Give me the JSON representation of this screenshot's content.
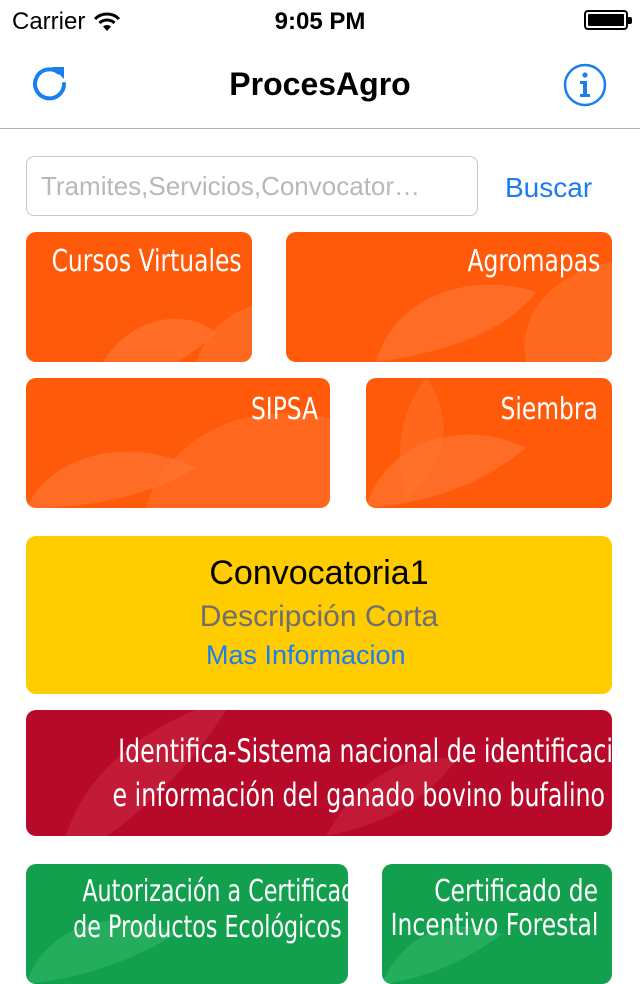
{
  "status_bar": {
    "carrier": "Carrier",
    "time": "9:05 PM"
  },
  "nav": {
    "title": "ProcesAgro",
    "refresh_icon": "refresh-icon",
    "info_icon": "info-icon"
  },
  "search": {
    "placeholder": "Tramites,Servicios,Convocator…",
    "value": "",
    "button_label": "Buscar"
  },
  "tiles": [
    {
      "label": "Cursos Virtuales",
      "color": "#ff5a0a"
    },
    {
      "label": "Agromapas",
      "color": "#ff5a0a"
    },
    {
      "label": "SIPSA",
      "color": "#ff5a0a"
    },
    {
      "label": "Siembra",
      "color": "#ff5a0a"
    }
  ],
  "convocatoria": {
    "title": "Convocatoria1",
    "description": "Descripción Corta",
    "link": "Mas Informacion",
    "color": "#ffcc00"
  },
  "identifica": {
    "line1": "Identifica-Sistema nacional de identificación",
    "line2": "e información del ganado bovino bufalino",
    "color": "#b70a2a"
  },
  "green_tiles": [
    {
      "line1": "Autorización a Certificadoras",
      "line2": "de Productos Ecológicos",
      "color": "#12a04e"
    },
    {
      "line1": "Certificado de",
      "line2": "Incentivo Forestal",
      "color": "#12a04e"
    }
  ],
  "colors": {
    "accent": "#1a7ef0"
  }
}
